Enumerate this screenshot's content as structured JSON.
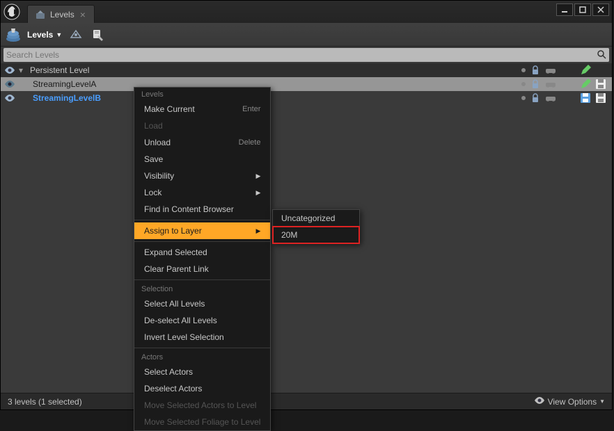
{
  "window": {
    "tab_title": "Levels"
  },
  "toolbar": {
    "levels_label": "Levels"
  },
  "search": {
    "placeholder": "Search Levels"
  },
  "tree": {
    "persistent": "Persistent Level",
    "levelA": "StreamingLevelA",
    "levelB": "StreamingLevelB"
  },
  "status": {
    "text": "3 levels (1 selected)",
    "view_options": "View Options"
  },
  "context_menu": {
    "section_levels": "Levels",
    "make_current": "Make Current",
    "make_current_shortcut": "Enter",
    "load": "Load",
    "unload": "Unload",
    "unload_shortcut": "Delete",
    "save": "Save",
    "visibility": "Visibility",
    "lock": "Lock",
    "find_in_browser": "Find in Content Browser",
    "assign_to_layer": "Assign to Layer",
    "expand_selected": "Expand Selected",
    "clear_parent_link": "Clear Parent Link",
    "section_selection": "Selection",
    "select_all_levels": "Select All Levels",
    "deselect_all_levels": "De-select All Levels",
    "invert_level_selection": "Invert Level Selection",
    "section_actors": "Actors",
    "select_actors": "Select Actors",
    "deselect_actors": "Deselect Actors",
    "move_actors": "Move Selected Actors to Level",
    "move_foliage": "Move Selected Foliage to Level"
  },
  "submenu": {
    "uncategorized": "Uncategorized",
    "twenty_m": "20M"
  }
}
